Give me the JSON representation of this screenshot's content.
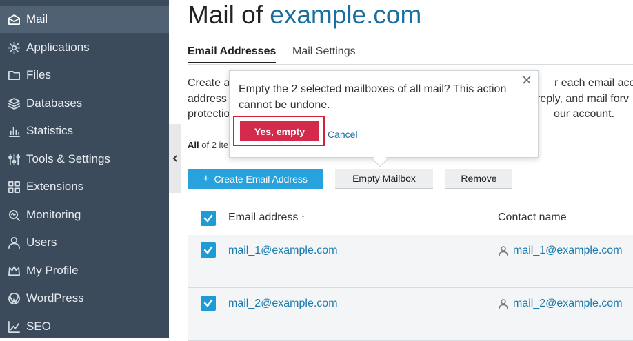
{
  "sidebar": {
    "items": [
      {
        "label": "Mail",
        "icon": "mail-icon",
        "active": true
      },
      {
        "label": "Applications",
        "icon": "gear-icon"
      },
      {
        "label": "Files",
        "icon": "folder-icon"
      },
      {
        "label": "Databases",
        "icon": "layers-icon"
      },
      {
        "label": "Statistics",
        "icon": "bar-chart-icon"
      },
      {
        "label": "Tools & Settings",
        "icon": "sliders-icon"
      },
      {
        "label": "Extensions",
        "icon": "grid-icon"
      },
      {
        "label": "Monitoring",
        "icon": "monitor-search-icon"
      },
      {
        "label": "Users",
        "icon": "user-icon"
      },
      {
        "label": "My Profile",
        "icon": "profile-crown-icon"
      },
      {
        "label": "WordPress",
        "icon": "wordpress-icon"
      },
      {
        "label": "SEO",
        "icon": "seo-chart-icon"
      }
    ]
  },
  "page": {
    "title_prefix": "Mail of",
    "title_domain": "example.com"
  },
  "tabs": [
    {
      "label": "Email Addresses",
      "active": true
    },
    {
      "label": "Mail Settings",
      "active": false
    }
  ],
  "description": {
    "line1_left": "Create a",
    "line1_right": "r each email accou",
    "line2_left": "address",
    "line2_right": "reply, and mail forv",
    "line3_left": "protectio",
    "line3_right": "our account."
  },
  "count": {
    "bold": "All",
    "rest": " of 2 ite"
  },
  "toolbar": {
    "create_label": "Create Email Address",
    "empty_label": "Empty Mailbox",
    "remove_label": "Remove"
  },
  "table": {
    "columns": [
      "Email address",
      "Contact name"
    ],
    "sort_indicator": "↑",
    "rows": [
      {
        "email": "mail_1@example.com",
        "contact": "mail_1@example.com",
        "checked": true
      },
      {
        "email": "mail_2@example.com",
        "contact": "mail_2@example.com",
        "checked": true
      }
    ]
  },
  "popover": {
    "message": "Empty the 2 selected mailboxes of all mail? This action cannot be undone.",
    "confirm_label": "Yes, empty",
    "cancel_label": "Cancel"
  },
  "colors": {
    "sidebar_bg": "#3c4b5b",
    "accent": "#28a2dc",
    "danger": "#d42a4b",
    "link": "#1a7bb0"
  }
}
